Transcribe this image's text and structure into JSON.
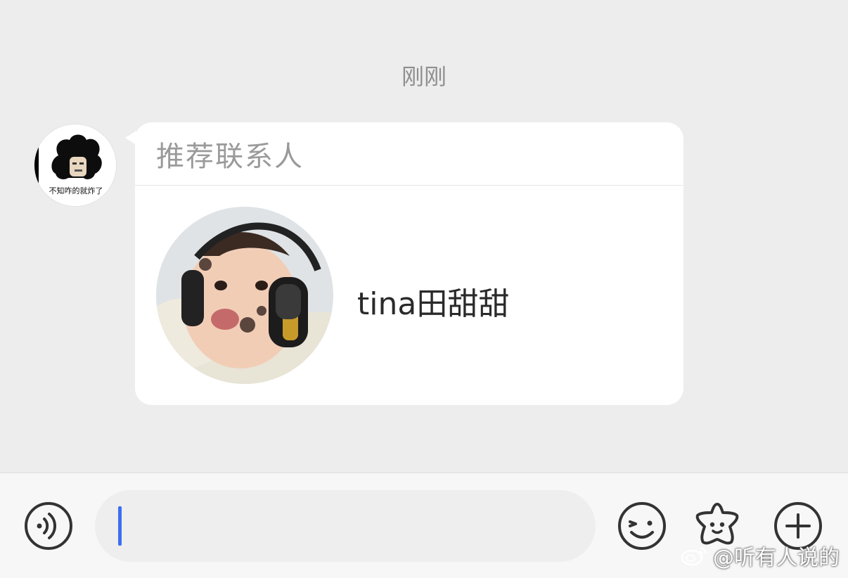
{
  "chat": {
    "timestamp": "刚刚",
    "sender_avatar_caption": "不知咋的就炸了",
    "card": {
      "title": "推荐联系人",
      "contact_name": "tina田甜甜"
    }
  },
  "input_bar": {
    "text_value": "",
    "voice_icon": "voice-icon",
    "emoji_icon": "emoji-icon",
    "sticker_icon": "sticker-icon",
    "plus_icon": "plus-icon"
  },
  "watermark": {
    "text": "@听有人说的"
  },
  "colors": {
    "chat_background": "#ededed",
    "bubble": "#ffffff",
    "caret": "#3b6ff0",
    "icon_stroke": "#333333"
  }
}
